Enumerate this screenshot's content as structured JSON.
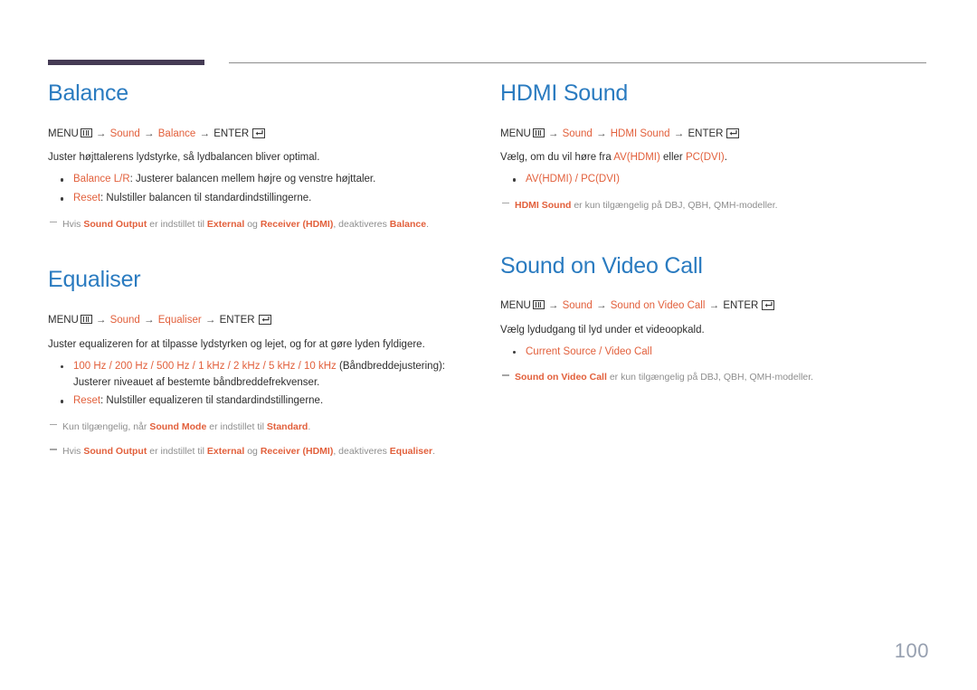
{
  "page": {
    "number": "100",
    "accent_blue": "#2a7bc0",
    "accent_orange": "#e2603c",
    "rule_dark": "#453b54",
    "rule_light": "#8c8c8c",
    "page_number_color": "#97a0b0"
  },
  "icons": {
    "menu": "menu-grid-icon",
    "enter": "enter-return-icon"
  },
  "sections": {
    "balance": {
      "title": "Balance",
      "path": {
        "menu_label": "MENU",
        "arrow": "→",
        "step1": "Sound",
        "step2": "Balance",
        "enter_label": "ENTER"
      },
      "lead": "Juster højttalerens lydstyrke, så lydbalancen bliver optimal.",
      "bullets": [
        {
          "term": "Balance L/R",
          "rest": ": Justerer balancen mellem højre og venstre højttaler."
        },
        {
          "term": "Reset",
          "rest": ": Nulstiller balancen til standardindstillingerne."
        }
      ],
      "notes": [
        {
          "p1": "Hvis ",
          "b1": "Sound Output",
          "p2": " er indstillet til ",
          "b2": "External",
          "p3": " og ",
          "b3": "Receiver (HDMI)",
          "p4": ", deaktiveres ",
          "b4": "Balance",
          "p5": "."
        }
      ]
    },
    "equaliser": {
      "title": "Equaliser",
      "path": {
        "menu_label": "MENU",
        "arrow": "→",
        "step1": "Sound",
        "step2": "Equaliser",
        "enter_label": "ENTER"
      },
      "lead": "Juster equalizeren for at tilpasse lydstyrken og lejet, og for at gøre lyden fyldigere.",
      "bullets": [
        {
          "term": "100 Hz / 200 Hz / 500 Hz / 1 kHz / 2 kHz / 5 kHz / 10 kHz",
          "rest": " (Båndbreddejustering): Justerer niveauet af bestemte båndbreddefrekvenser."
        },
        {
          "term": "Reset",
          "rest": ": Nulstiller equalizeren til standardindstillingerne."
        }
      ],
      "notes": [
        {
          "p1": "Kun tilgængelig, når ",
          "b1": "Sound Mode",
          "p2": " er indstillet til ",
          "b2": "Standard",
          "p3": ".",
          "b3": "",
          "p4": "",
          "b4": "",
          "p5": ""
        },
        {
          "p1": "Hvis ",
          "b1": "Sound Output",
          "p2": " er indstillet til ",
          "b2": "External",
          "p3": " og ",
          "b3": "Receiver (HDMI)",
          "p4": ", deaktiveres ",
          "b4": "Equaliser",
          "p5": "."
        }
      ]
    },
    "hdmi_sound": {
      "title": "HDMI Sound",
      "path": {
        "menu_label": "MENU",
        "arrow": "→",
        "step1": "Sound",
        "step2": "HDMI Sound",
        "enter_label": "ENTER"
      },
      "lead_p1": "Vælg, om du vil høre fra ",
      "lead_o1": "AV(HDMI)",
      "lead_p2": " eller ",
      "lead_o2": "PC(DVI)",
      "lead_p3": ".",
      "bullets": [
        {
          "term": "AV(HDMI) / PC(DVI)",
          "rest": ""
        }
      ],
      "notes": [
        {
          "p1": "",
          "b1": "HDMI Sound",
          "p2": " er kun tilgængelig på DBJ, QBH, QMH-modeller.",
          "b2": "",
          "p3": "",
          "b3": "",
          "p4": "",
          "b4": "",
          "p5": ""
        }
      ]
    },
    "sound_on_video_call": {
      "title": "Sound on Video Call",
      "path": {
        "menu_label": "MENU",
        "arrow": "→",
        "step1": "Sound",
        "step2": "Sound on Video Call",
        "enter_label": "ENTER"
      },
      "lead": "Vælg lydudgang til lyd under et videoopkald.",
      "bullets": [
        {
          "term": "Current Source / Video Call",
          "rest": ""
        }
      ],
      "notes": [
        {
          "p1": "",
          "b1": "Sound on Video Call",
          "p2": " er kun tilgængelig på DBJ, QBH, QMH-modeller.",
          "b2": "",
          "p3": "",
          "b3": "",
          "p4": "",
          "b4": "",
          "p5": ""
        }
      ]
    }
  }
}
